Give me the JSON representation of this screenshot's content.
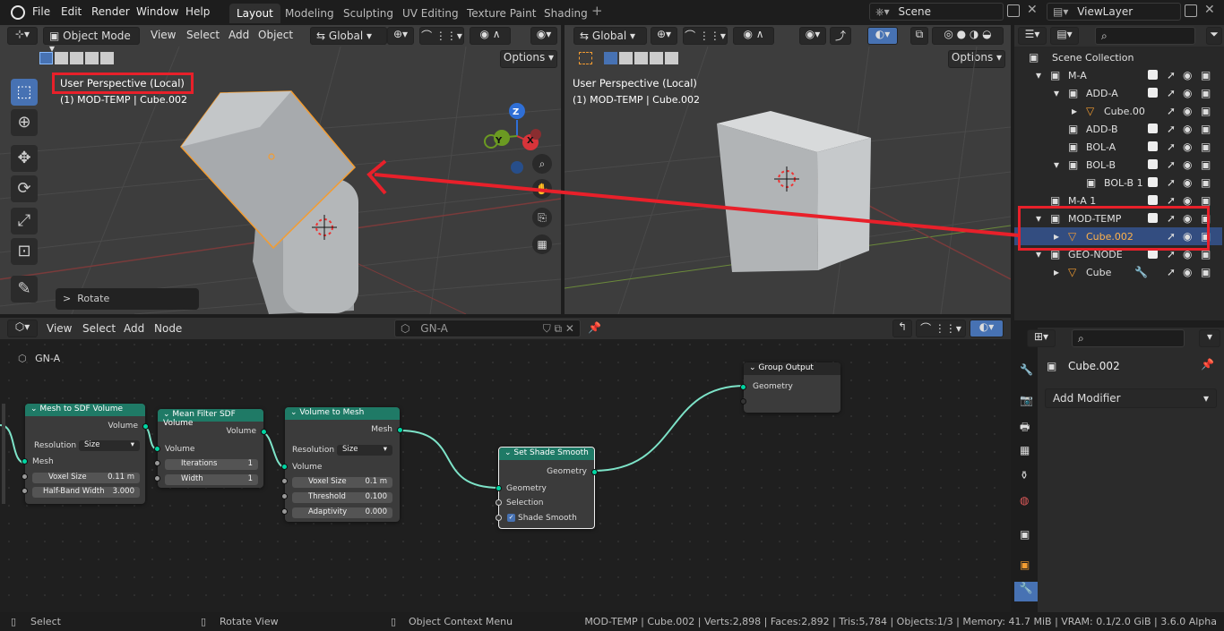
{
  "menu": {
    "file": "File",
    "edit": "Edit",
    "render": "Render",
    "window": "Window",
    "help": "Help"
  },
  "workspaces": [
    "Layout",
    "Modeling",
    "Sculpting",
    "UV Editing",
    "Texture Paint",
    "Shading"
  ],
  "scene": "Scene",
  "view_layer": "ViewLayer",
  "viewport_left": {
    "mode": "Object Mode",
    "menus": [
      "View",
      "Select",
      "Add",
      "Object"
    ],
    "orientation": "Global",
    "options": "Options",
    "overlay_title": "User Perspective (Local)",
    "overlay_sub": "(1) MOD-TEMP | Cube.002",
    "last_op": "Rotate",
    "gizmo": {
      "z": "Z",
      "y": "Y",
      "x": "X"
    }
  },
  "viewport_right": {
    "orientation": "Global",
    "options": "Options",
    "overlay_title": "User Perspective (Local)",
    "overlay_sub": "(1) MOD-TEMP | Cube.002"
  },
  "outliner": {
    "title": "Scene Collection",
    "rows": [
      "M-A",
      "ADD-A",
      "Cube.00",
      "ADD-B",
      "BOL-A",
      "BOL-B",
      "BOL-B 1",
      "M-A 1",
      "MOD-TEMP",
      "Cube.002",
      "GEO-NODE",
      "Cube"
    ]
  },
  "properties": {
    "object": "Cube.002",
    "add_modifier": "Add Modifier"
  },
  "node_editor": {
    "menus": [
      "View",
      "Select",
      "Add",
      "Node"
    ],
    "tree": "GN-A",
    "breadcrumb": "GN-A",
    "nodes": {
      "mesh_to_sdf": {
        "title": "Mesh to SDF Volume",
        "out": "Volume",
        "res_label": "Resolution",
        "res_value": "Size",
        "mesh": "Mesh",
        "voxel_label": "Voxel Size",
        "voxel_value": "0.11 m",
        "hb_label": "Half-Band Width",
        "hb_value": "3.000"
      },
      "mean_filter": {
        "title": "Mean Filter SDF Volume",
        "out": "Volume",
        "in": "Volume",
        "iter_label": "Iterations",
        "iter_value": "1",
        "width_label": "Width",
        "width_value": "1"
      },
      "vol_to_mesh": {
        "title": "Volume to Mesh",
        "out": "Mesh",
        "res_label": "Resolution",
        "res_value": "Size",
        "in": "Volume",
        "voxel_label": "Voxel Size",
        "voxel_value": "0.1 m",
        "thr_label": "Threshold",
        "thr_value": "0.100",
        "adapt_label": "Adaptivity",
        "adapt_value": "0.000"
      },
      "shade_smooth": {
        "title": "Set Shade Smooth",
        "out": "Geometry",
        "geom": "Geometry",
        "sel": "Selection",
        "smooth": "Shade Smooth"
      },
      "group_output": {
        "title": "Group Output",
        "geom": "Geometry"
      }
    }
  },
  "status": {
    "select": "Select",
    "rotate": "Rotate View",
    "context": "Object Context Menu",
    "info": "MOD-TEMP | Cube.002 | Verts:2,898 | Faces:2,892 | Tris:5,784 | Objects:1/3 | Memory: 41.7 MiB | VRAM: 0.1/2.0 GiB | 3.6.0 Alpha"
  },
  "colors": {
    "accent": "#4772b3",
    "node_header": "#1f7a66",
    "socket": "#00d6a3",
    "annotation": "#e8202a",
    "selected": "#ff8c1a"
  }
}
